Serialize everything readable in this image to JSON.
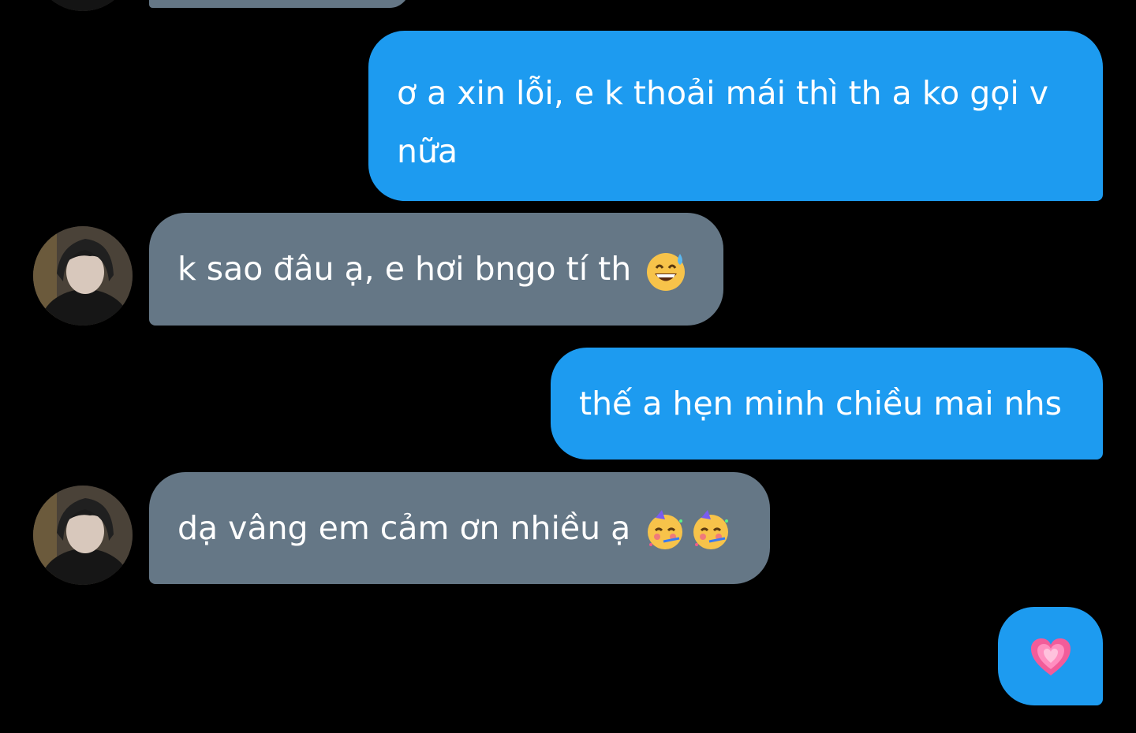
{
  "colors": {
    "background": "#000000",
    "outgoing_bubble": "#1d9bf0",
    "incoming_bubble": "#657786",
    "text": "#ffffff"
  },
  "messages": [
    {
      "side": "incoming",
      "text": "",
      "note": "partially visible bubble cut off at top"
    },
    {
      "side": "outgoing",
      "line1": "ơ a xin lỗi, e k thoải mái thì th a ko gọi v",
      "line2": "nữa"
    },
    {
      "side": "incoming",
      "text": "k sao đâu ạ, e hơi bngo tí th",
      "emoji": "grinning-face-with-sweat-icon"
    },
    {
      "side": "outgoing",
      "text": "thế a hẹn minh chiều mai nhs"
    },
    {
      "side": "incoming",
      "text": "dạ vâng em cảm ơn nhiều ạ",
      "emoji": "partying-face-icon"
    },
    {
      "side": "outgoing",
      "text": "",
      "emoji": "growing-heart-icon"
    }
  ]
}
